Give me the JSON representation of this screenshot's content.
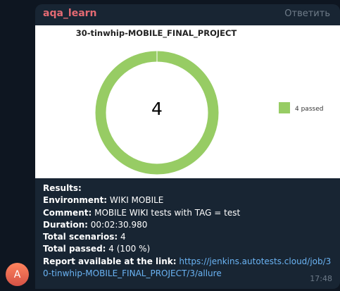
{
  "message": {
    "sender": "aqa_learn",
    "reply_label": "Ответить",
    "time": "17:48",
    "avatar_letter": "A",
    "colors": {
      "sender": "#e46a73",
      "link": "#6ab3f3",
      "bubble": "#182533",
      "passed": "#97cc64"
    }
  },
  "chart_data": {
    "type": "pie",
    "title": "30-tinwhip-MOBILE_FINAL_PROJECT",
    "center_label": "4",
    "series": [
      {
        "name": "4 passed",
        "values": [
          4
        ]
      }
    ],
    "total": 4,
    "legend_position": "right"
  },
  "results": {
    "heading": "Results:",
    "environment_label": "Environment:",
    "environment_value": " WIKI MOBILE",
    "comment_label": "Comment:",
    "comment_value": " MOBILE WIKI tests with TAG = test",
    "duration_label": "Duration:",
    "duration_value": " 00:02:30.980",
    "scenarios_label": "Total scenarios:",
    "scenarios_value": " 4",
    "passed_label": "Total passed:",
    "passed_value": " 4 (100 %)",
    "report_label": "Report available at the link:",
    "report_url": "https://jenkins.autotests.cloud/job/30-tinwhip-MOBILE_FINAL_PROJECT/3/allure"
  }
}
